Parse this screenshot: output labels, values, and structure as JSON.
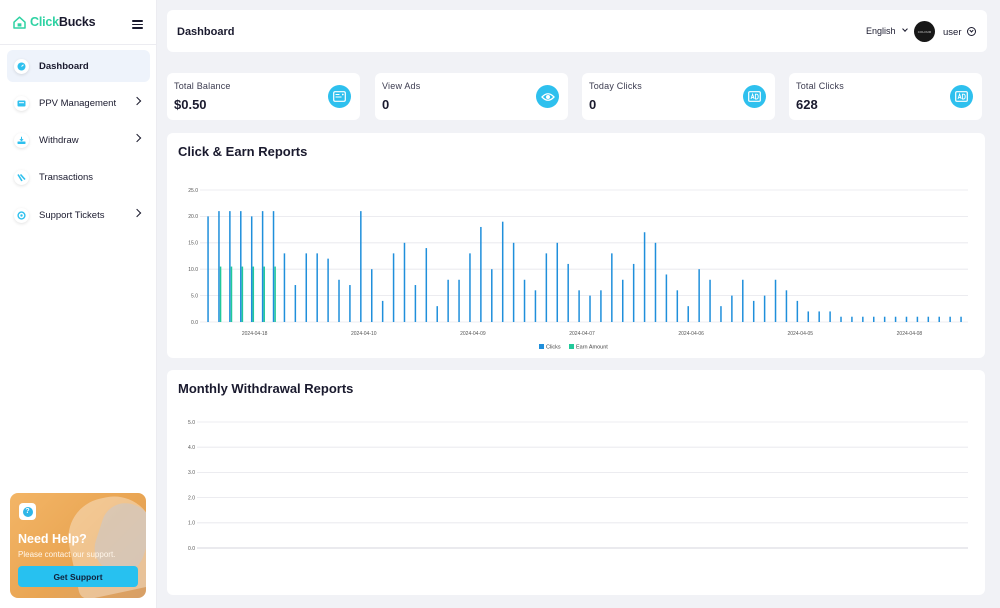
{
  "app": {
    "logo_part1": "Click",
    "logo_part2": "Bucks"
  },
  "sidebar": {
    "items": [
      {
        "label": "Dashboard",
        "icon": "dashboard-icon",
        "active": true,
        "has_submenu": false
      },
      {
        "label": "PPV Management",
        "icon": "ppv-icon",
        "active": false,
        "has_submenu": true
      },
      {
        "label": "Withdraw",
        "icon": "withdraw-icon",
        "active": false,
        "has_submenu": true
      },
      {
        "label": "Transactions",
        "icon": "transactions-icon",
        "active": false,
        "has_submenu": false
      },
      {
        "label": "Support Tickets",
        "icon": "support-icon",
        "active": false,
        "has_submenu": true
      }
    ],
    "help": {
      "title": "Need Help?",
      "subtitle": "Please contact our support.",
      "button": "Get Support"
    }
  },
  "header": {
    "title": "Dashboard",
    "language": "English",
    "avatar_text": "COLOUR",
    "user": "user"
  },
  "stats": [
    {
      "label": "Total Balance",
      "value": "$0.50",
      "icon": "wallet-icon"
    },
    {
      "label": "View Ads",
      "value": "0",
      "icon": "eye-icon"
    },
    {
      "label": "Today Clicks",
      "value": "0",
      "icon": "ad-icon"
    },
    {
      "label": "Total Clicks",
      "value": "628",
      "icon": "ad-icon"
    }
  ],
  "colors": {
    "accent": "#2ec0ee",
    "clicks": "#1f8fdb",
    "earn": "#21c99a",
    "logo_green": "#2fd2a3"
  },
  "chart_data": [
    {
      "type": "bar",
      "title": "Click & Earn Reports",
      "ylim": [
        0,
        25
      ],
      "yticks": [
        "0.0",
        "5.0",
        "10.0",
        "15.0",
        "20.0",
        "25.0"
      ],
      "x_tick_labels": [
        "2024-04-18",
        "2024-04-10",
        "2024-04-09",
        "2024-04-07",
        "2024-04-06",
        "2024-04-05",
        "2024-04-08"
      ],
      "legend_position": "bottom-center",
      "grid": true,
      "series": [
        {
          "name": "Clicks",
          "color": "#1f8fdb",
          "values": [
            20,
            21,
            21,
            21,
            20,
            21,
            21,
            13,
            7,
            13,
            13,
            12,
            8,
            7,
            21,
            10,
            4,
            13,
            15,
            7,
            14,
            3,
            8,
            8,
            13,
            18,
            10,
            19,
            15,
            8,
            6,
            13,
            15,
            11,
            6,
            5,
            6,
            13,
            8,
            11,
            17,
            15,
            9,
            6,
            3,
            10,
            8,
            3,
            5,
            8,
            4,
            5,
            8,
            6,
            4,
            2,
            2,
            2,
            1,
            1,
            1,
            1,
            1,
            1,
            1,
            1,
            1,
            1,
            1,
            1
          ]
        },
        {
          "name": "Earn Amount",
          "color": "#21c99a",
          "values": [
            0,
            10.5,
            10.5,
            10.5,
            10.5,
            10.5,
            10.5,
            0,
            0,
            0,
            0,
            0,
            0,
            0,
            0,
            0,
            0,
            0,
            0,
            0,
            0,
            0,
            0,
            0,
            0,
            0,
            0,
            0,
            0,
            0,
            0,
            0,
            0,
            0,
            0,
            0,
            0,
            0,
            0,
            0,
            0,
            0,
            0,
            0,
            0,
            0,
            0,
            0,
            0,
            0,
            0,
            0,
            0,
            0,
            0,
            0,
            0,
            0,
            0,
            0,
            0,
            0,
            0,
            0,
            0,
            0,
            0,
            0,
            0,
            0
          ]
        }
      ]
    },
    {
      "type": "bar",
      "title": "Monthly Withdrawal Reports",
      "ylim": [
        0,
        5
      ],
      "yticks": [
        "0.0",
        "1.0",
        "2.0",
        "3.0",
        "4.0",
        "5.0"
      ],
      "grid": true,
      "series": []
    }
  ]
}
